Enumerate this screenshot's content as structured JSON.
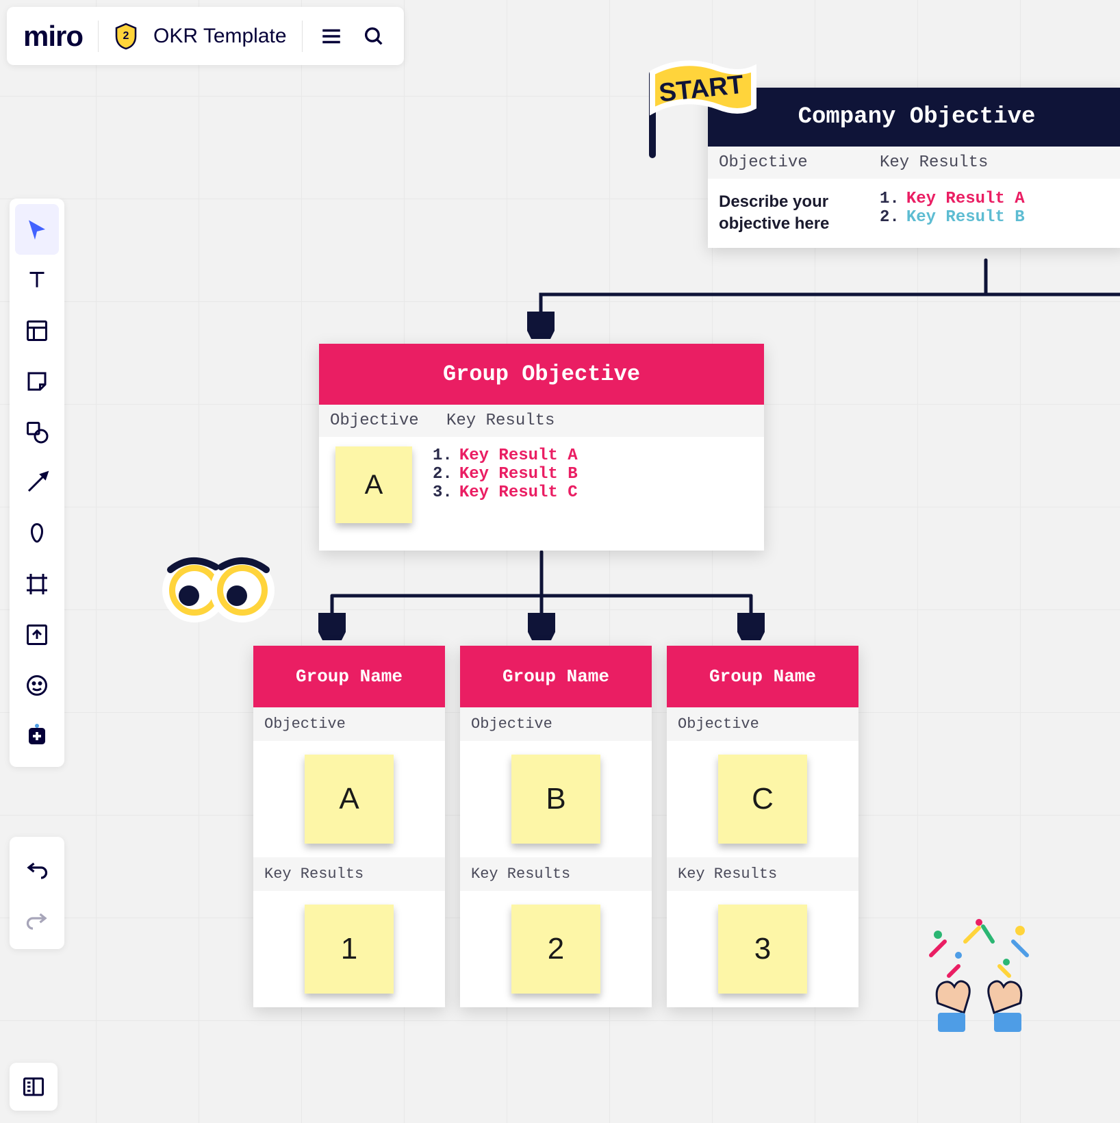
{
  "topbar": {
    "logo_text": "miro",
    "badge_number": "2",
    "board_title": "OKR Template"
  },
  "toolbar": {
    "items": [
      {
        "name": "select-tool",
        "selected": true
      },
      {
        "name": "text-tool",
        "selected": false
      },
      {
        "name": "templates-tool",
        "selected": false
      },
      {
        "name": "sticky-note-tool",
        "selected": false
      },
      {
        "name": "shape-tool",
        "selected": false
      },
      {
        "name": "arrow-tool",
        "selected": false
      },
      {
        "name": "pen-tool",
        "selected": false
      },
      {
        "name": "frame-tool",
        "selected": false
      },
      {
        "name": "upload-tool",
        "selected": false
      },
      {
        "name": "comment-tool",
        "selected": false
      },
      {
        "name": "more-apps-tool",
        "selected": false
      }
    ],
    "undo_label": "Undo",
    "redo_label": "Redo"
  },
  "stickers": {
    "start_flag_text": "START"
  },
  "company_card": {
    "title": "Company Objective",
    "objective_label": "Objective",
    "key_results_label": "Key Results",
    "objective_text": "Describe your objective here",
    "key_results": [
      {
        "num": "1.",
        "text": "Key Result A",
        "class": "kr-a"
      },
      {
        "num": "2.",
        "text": "Key Result B",
        "class": "kr-b"
      }
    ]
  },
  "group_objective_card": {
    "title": "Group Objective",
    "objective_label": "Objective",
    "key_results_label": "Key Results",
    "sticky_letter": "A",
    "key_results": [
      {
        "num": "1.",
        "text": "Key Result A"
      },
      {
        "num": "2.",
        "text": "Key Result B"
      },
      {
        "num": "3.",
        "text": "Key Result C"
      }
    ]
  },
  "groups": [
    {
      "title": "Group Name",
      "objective_label": "Objective",
      "objective_letter": "A",
      "key_results_label": "Key Results",
      "key_results_value": "1"
    },
    {
      "title": "Group Name",
      "objective_label": "Objective",
      "objective_letter": "B",
      "key_results_label": "Key Results",
      "key_results_value": "2"
    },
    {
      "title": "Group Name",
      "objective_label": "Objective",
      "objective_letter": "C",
      "key_results_label": "Key Results",
      "key_results_value": "3"
    }
  ]
}
